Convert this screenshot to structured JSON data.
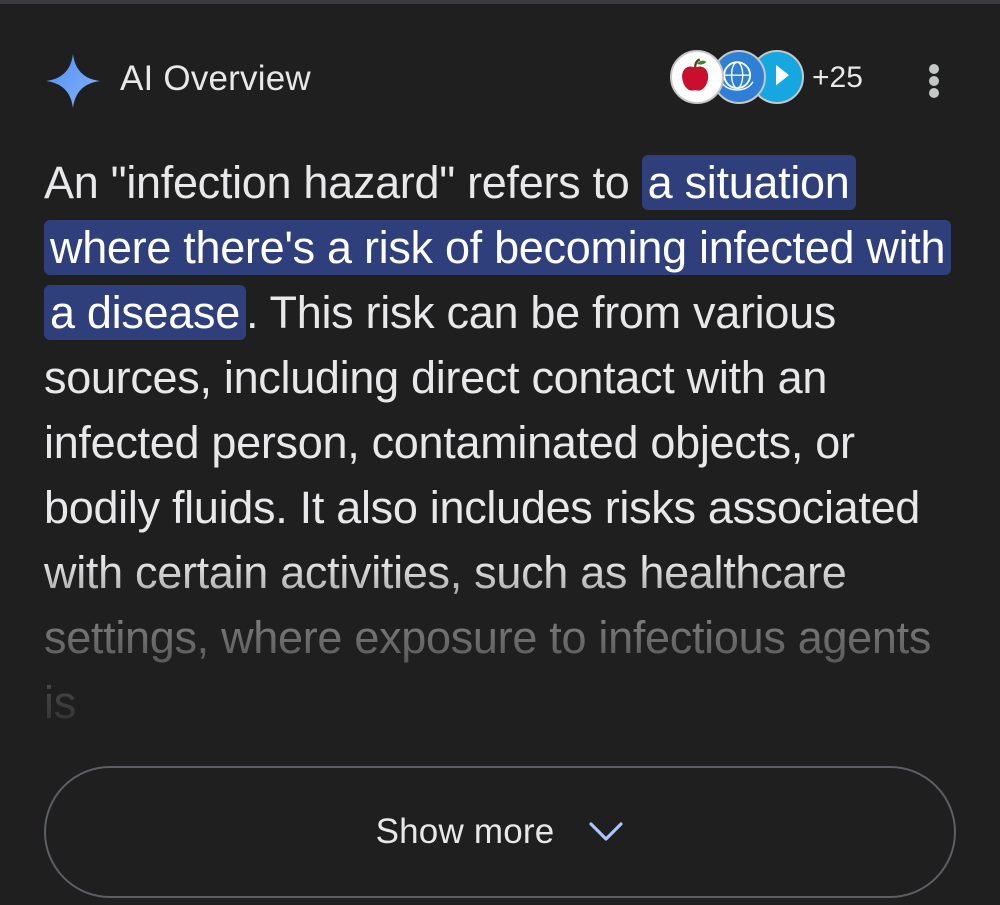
{
  "header": {
    "title": "AI Overview",
    "sources": [
      {
        "icon": "apple-icon",
        "color": "#c8102e"
      },
      {
        "icon": "globe-emblem-icon",
        "color": "#2f7fd6"
      },
      {
        "icon": "play-icon",
        "color": "#16a6e0"
      }
    ],
    "more_sources": "+25"
  },
  "overview": {
    "intro": "An \"infection hazard\" refers to ",
    "highlight": "a situation where there's a risk of becoming infected with a disease",
    "rest": ". This risk can be from various sources, including direct contact with an infected person, contaminated objects, or bodily fluids. It also includes risks associated with certain activities, such as healthcare settings, where exposure to infectious agents is"
  },
  "actions": {
    "show_more": "Show more"
  },
  "colors": {
    "background": "#1f1f1f",
    "highlight": "#2f3f7c",
    "accent_blue": "#a8c7fa"
  }
}
